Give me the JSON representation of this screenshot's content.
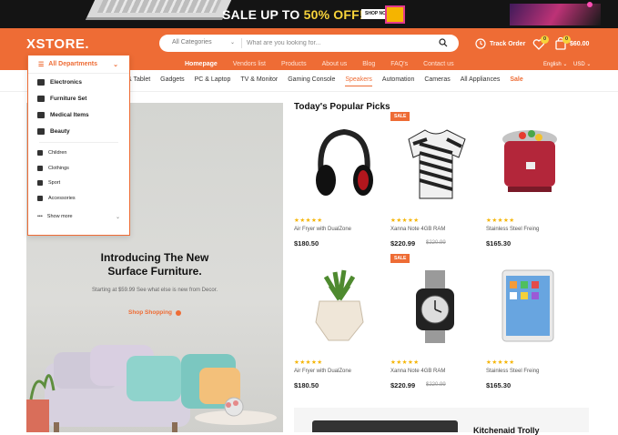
{
  "promo": {
    "text_a": "SALE UP TO ",
    "text_b": "50% OFF!",
    "button": "SHOP NOW"
  },
  "header": {
    "logo": "XSTORE.",
    "search": {
      "category": "All Categories",
      "placeholder": "What are you looking for..."
    },
    "track_order": "Track Order",
    "wishlist_count": "0",
    "cart_count": "0",
    "cart_total": "$60.00",
    "links": [
      "Homepage",
      "Vendors list",
      "Products",
      "About us",
      "Blog",
      "FAQ's",
      "Contact us"
    ],
    "language": "English ⌄",
    "currency": "USD ⌄"
  },
  "category_nav": [
    "& Tablet",
    "Gadgets",
    "PC & Laptop",
    "TV & Monitor",
    "Gaming Console",
    "Speakers",
    "Automation",
    "Cameras",
    "All Appliances",
    "Sale"
  ],
  "departments": {
    "title": "All Departments",
    "main": [
      "Electronics",
      "Furniture Set",
      "Medical Items",
      "Beauty"
    ],
    "secondary": [
      "Children",
      "Clothings",
      "Sport",
      "Accessories"
    ],
    "more": "Show more"
  },
  "hero": {
    "title_line1": "Introducing The New",
    "title_line2": "Surface Furniture.",
    "subtitle": "Starting at $59.99 See what else is new from Decor.",
    "cta": "Shop Shopping"
  },
  "popular": {
    "title": "Today's Popular Picks",
    "products": [
      {
        "name": "Air Fryer with DualZone",
        "price": "$180.50",
        "old_price": "",
        "sale": "",
        "stars": "★★★★★",
        "icon": "headphones-icon"
      },
      {
        "name": "Xanna Note 4GB RAM",
        "price": "$220.99",
        "old_price": "$220.99",
        "sale": "SALE",
        "stars": "★★★★★",
        "icon": "tshirt-icon"
      },
      {
        "name": "Stainless Steel Freing",
        "price": "$165.30",
        "old_price": "",
        "sale": "",
        "stars": "★★★★★",
        "icon": "rice-cooker-icon"
      },
      {
        "name": "Air Fryer with DualZone",
        "price": "$180.50",
        "old_price": "",
        "sale": "",
        "stars": "★★★★★",
        "icon": "plant-pot-icon"
      },
      {
        "name": "Xanna Note 4GB RAM",
        "price": "$220.99",
        "old_price": "$220.99",
        "sale": "SALE",
        "stars": "★★★★★",
        "icon": "smartwatch-icon"
      },
      {
        "name": "Stainless Steel Freing",
        "price": "$165.30",
        "old_price": "",
        "sale": "",
        "stars": "★★★★★",
        "icon": "tablet-icon"
      }
    ]
  },
  "bottom_card": {
    "title": "Kitchenaid Trolly"
  },
  "colors": {
    "brand": "#ee6c35",
    "star": "#f5b400",
    "badge": "#f7d33b"
  }
}
